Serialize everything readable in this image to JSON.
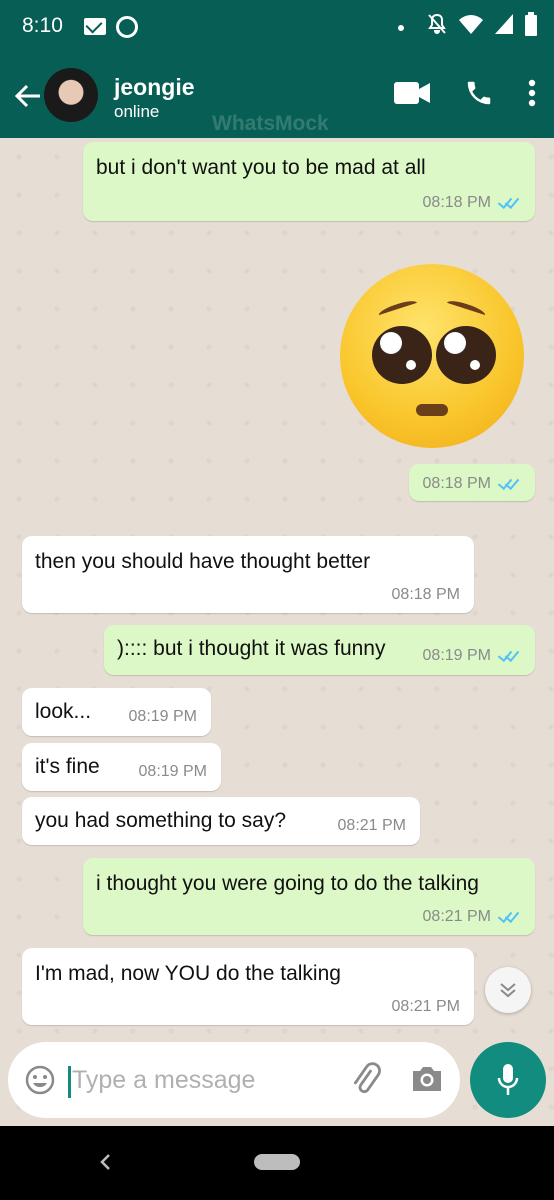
{
  "status_bar": {
    "time": "8:10",
    "icons": [
      "mail-icon",
      "shazam-icon",
      "notification-dot",
      "do-not-disturb-icon",
      "wifi-icon",
      "signal-icon",
      "battery-icon"
    ]
  },
  "header": {
    "contact_name": "jeongie",
    "contact_status": "online",
    "watermark": "WhatsMock",
    "icons": [
      "back-arrow-icon",
      "video-call-icon",
      "voice-call-icon",
      "more-vert-icon"
    ]
  },
  "messages": [
    {
      "direction": "out",
      "text": "but i don't want you to be mad at all",
      "time": "08:18 PM",
      "read": true
    },
    {
      "direction": "out",
      "emoji": "pleading-face",
      "text": "",
      "time": "08:18 PM",
      "read": true
    },
    {
      "direction": "in",
      "text": "then you should have thought better",
      "time": "08:18 PM"
    },
    {
      "direction": "out",
      "text": "):::: but i thought it was funny",
      "time": "08:19 PM",
      "read": true
    },
    {
      "direction": "in",
      "text": "look...",
      "time": "08:19 PM"
    },
    {
      "direction": "in",
      "text": "it's fine",
      "time": "08:19 PM"
    },
    {
      "direction": "in",
      "text": "you had something to say?",
      "time": "08:21 PM"
    },
    {
      "direction": "out",
      "text": "i thought you were going to do the talking",
      "time": "08:21 PM",
      "read": true
    },
    {
      "direction": "in",
      "text": "I'm mad, now YOU do the talking",
      "time": "08:21 PM"
    }
  ],
  "composer": {
    "placeholder": "Type a message",
    "value": ""
  },
  "colors": {
    "header": "#075e54",
    "chat_background": "#e6ddd4",
    "outgoing_bubble": "#dcf8c6",
    "incoming_bubble": "#ffffff",
    "read_ticks": "#4fc3f7",
    "mic_button": "#128c7e"
  }
}
